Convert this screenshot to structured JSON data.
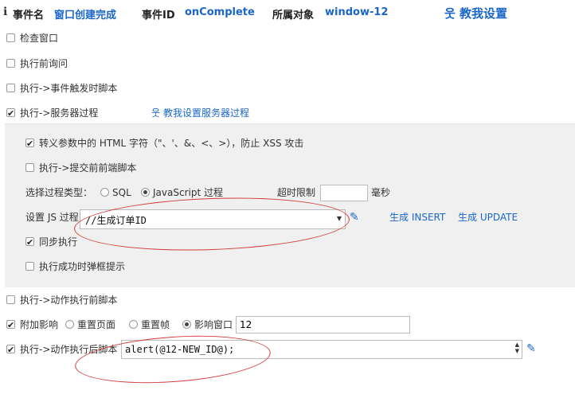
{
  "header": {
    "event_name_label": "事件名",
    "event_name_value": "窗口创建完成",
    "event_id_label": "事件ID",
    "event_id_value": "onComplete",
    "owner_label": "所属对象",
    "owner_value": "window-12",
    "help_text": "教我设置"
  },
  "options": {
    "check_window": "检查窗口",
    "ask_before": "执行前询问",
    "event_trigger_script": "执行->事件触发时脚本",
    "server_process": "执行->服务器过程",
    "server_help_link": "教我设置服务器过程"
  },
  "server_panel": {
    "escape_html": "转义参数中的 HTML 字符（\"、'、&、<、>），防止 XSS 攻击",
    "submit_front_script": "执行->提交前前端脚本",
    "process_type_label": "选择过程类型：",
    "type_sql": "SQL",
    "type_js": "JavaScript 过程",
    "timeout_label": "超时限制",
    "timeout_value": "",
    "timeout_unit": "毫秒",
    "set_js_label": "设置 JS 过程",
    "js_process_value": "//生成订单ID",
    "gen_insert": "生成 INSERT",
    "gen_update": "生成 UPDATE",
    "sync_exec": "同步执行",
    "success_popup": "执行成功时弹框提示"
  },
  "actions": {
    "before_action_script": "执行->动作执行前脚本",
    "attach_effect": "附加影响",
    "reset_page": "重置页面",
    "reset_frame": "重置帧",
    "affect_window": "影响窗口",
    "affect_window_value": "12",
    "after_action_script": "执行->动作执行后脚本",
    "after_script_value": "alert(@12-NEW_ID@);"
  },
  "colors": {
    "accent": "#1a66c9",
    "panel_bg": "#f0f0f0",
    "annotation": "#d43b3b"
  }
}
